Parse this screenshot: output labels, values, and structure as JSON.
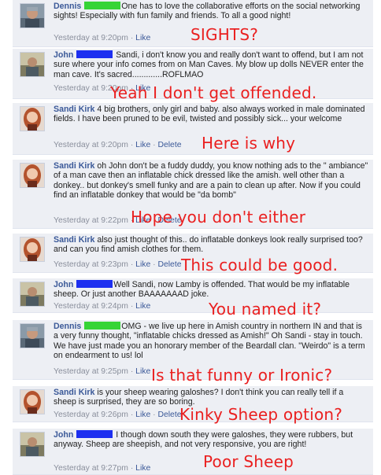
{
  "colors": {
    "comment_bg": "#edeff4",
    "link": "#3b5998",
    "meta": "#8a8f9c",
    "redact_blue": "#1d2ff0",
    "redact_green": "#36d436",
    "annotation": "#ea2020"
  },
  "comments": [
    {
      "author": "Dennis",
      "redact": "green",
      "text": "One has to love the collaborative efforts on the social networking sights! Especially with fun family and friends. To all a good night!",
      "time": "Yesterday at 9:20pm",
      "like": "Like",
      "delete": ""
    },
    {
      "author": "John",
      "redact": "blue",
      "text": "Sandi, i don't know you and really don't want to offend, but I am not sure where your info comes from on Man Caves. My blow up dolls NEVER enter the man cave. It's sacred.............ROFLMAO",
      "time": "Yesterday at 9:20pm",
      "like": "Like",
      "delete": ""
    },
    {
      "author": "Sandi Kirk",
      "redact": "",
      "text": "4 big brothers, only girl and baby. also always worked in male dominated fields. I have been pruned to be evil, twisted and possibly sick... your welcome",
      "time": "Yesterday at 9:20pm",
      "like": "Like",
      "delete": "Delete"
    },
    {
      "author": "Sandi Kirk",
      "redact": "",
      "text": "oh John don't be a fuddy duddy, you know nothing ads to the \" ambiance\" of a man cave then an inflatable chick dressed like the amish. well other than a donkey.. but donkey's smell funky and are a pain to clean up after. Now if you could find an inflatable donkey that would be \"da bomb\"",
      "time": "Yesterday at 9:22pm",
      "like": "Like",
      "delete": "Delete"
    },
    {
      "author": "Sandi Kirk",
      "redact": "",
      "text": "also just thought of this.. do inflatable donkeys look really surprised too? and can you find amish clothes for them.",
      "time": "Yesterday at 9:23pm",
      "like": "Like",
      "delete": "Delete"
    },
    {
      "author": "John",
      "redact": "blue",
      "text": "Well Sandi, now Lamby is offended. That would be my inflatable sheep. Or just another BAAAAAAAD joke.",
      "time": "Yesterday at 9:24pm",
      "like": "Like",
      "delete": ""
    },
    {
      "author": "Dennis",
      "redact": "green",
      "text": "OMG - we live up here in Amish country in northern IN and that is a very funny thought, \"inflatable chicks dressed as Amish!\" Oh Sandi - stay in touch. We have just made you an honorary member of the Beardall clan. \"Weirdo\" is a term on endearment to us! lol",
      "time": "Yesterday at 9:25pm",
      "like": "Like",
      "delete": ""
    },
    {
      "author": "Sandi Kirk",
      "redact": "",
      "text": "is your sheep wearing galoshes? I don't think you can really tell if a sheep is surprised, they are so boring.",
      "time": "Yesterday at 9:26pm",
      "like": "Like",
      "delete": "Delete"
    },
    {
      "author": "John",
      "redact": "blue",
      "text": "I though down south they were galoshes, they were rubbers, but anyway. Sheep are sheepish, and not very responsive, you are right!",
      "time": "Yesterday at 9:27pm",
      "like": "Like",
      "delete": ""
    }
  ],
  "annotations": [
    "SIGHTS?",
    "Yeah I don't get offended.",
    "Here is why",
    "Hope you don't either",
    "This could be good.",
    "You named it?",
    "Is that funny or Ironic?",
    "Kinky Sheep option?",
    "Poor Sheep"
  ]
}
